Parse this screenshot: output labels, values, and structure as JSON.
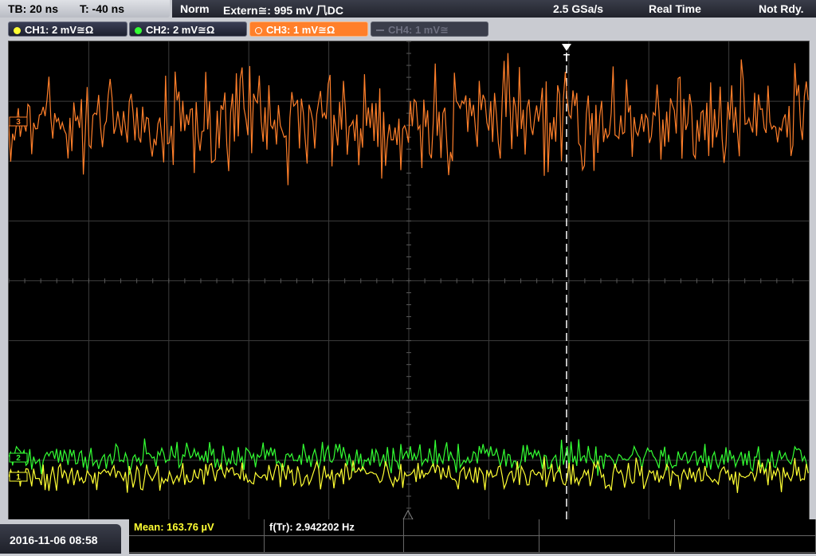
{
  "topbar": {
    "timebase": "TB: 20 ns",
    "trigger_time": "T: -40 ns",
    "trigger_mode": "Norm",
    "trigger_source": "Extern≅: 995 mV ⺇DC",
    "sample_rate": "2.5 GSa/s",
    "acq_mode": "Real Time",
    "status": "Not Rdy."
  },
  "channels": [
    {
      "label": "CH1: 2 mV≅Ω",
      "color": "#ffff33",
      "state": "on"
    },
    {
      "label": "CH2: 2 mV≅Ω",
      "color": "#33ff33",
      "state": "on"
    },
    {
      "label": "CH3: 1 mV≅Ω",
      "color": "#ff7f2a",
      "state": "active"
    },
    {
      "label": "CH4: 1 mV≅",
      "color": "#6e7080",
      "state": "off"
    }
  ],
  "markers": {
    "ch1": "1",
    "ch2": "2",
    "ch3": "3",
    "trigger": "T"
  },
  "bottom": {
    "datetime": "2016-11-06 08:58",
    "mean": "Mean: 163.76 µV",
    "freq": "f(Tr): 2.942202 Hz"
  },
  "colors": {
    "ch1": "#ffff33",
    "ch2": "#33ff33",
    "ch3": "#ff7f2a",
    "grid": "#3c3c3c"
  }
}
